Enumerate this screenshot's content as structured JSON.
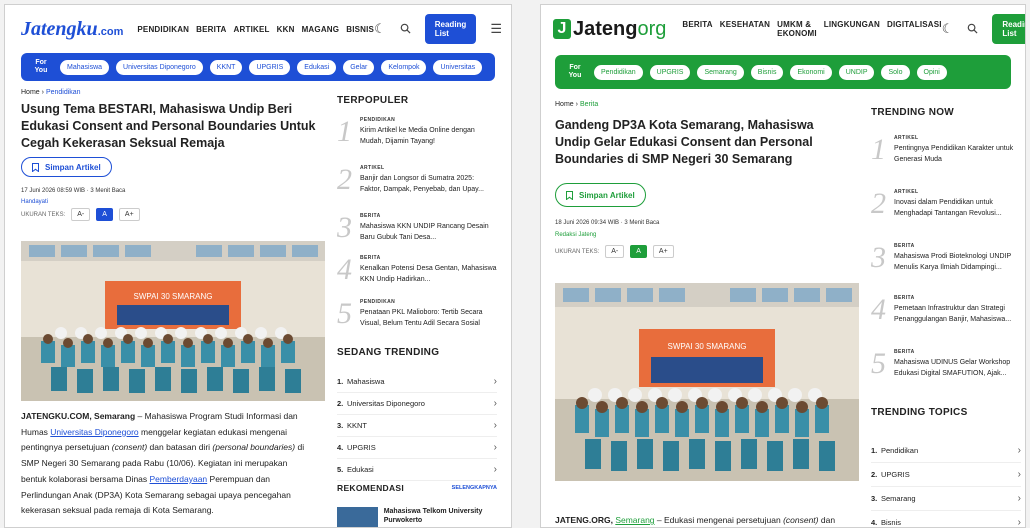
{
  "left": {
    "logo_main": "Jatengku",
    "logo_domain": ".com",
    "nav": [
      "PENDIDIKAN",
      "BERITA",
      "ARTIKEL",
      "KKN",
      "MAGANG",
      "BISNIS"
    ],
    "reading_list": "Reading List",
    "for_you": "For You",
    "tags": [
      "Mahasiswa",
      "Universitas Diponegoro",
      "KKNT",
      "UPGRIS",
      "Edukasi",
      "Gelar",
      "Kelompok",
      "Universitas"
    ],
    "crumb_home": "Home",
    "crumb_sep": "›",
    "crumb_cat": "Pendidikan",
    "title": "Usung Tema BESTARI, Mahasiswa Undip Beri Edukasi Consent and Personal Boundaries Untuk Cegah Kekerasan Seksual Remaja",
    "save": "Simpan Artikel",
    "meta": "17 Juni 2026 08:59 WIB · 3 Menit Baca",
    "author": "Handayati",
    "fontsize_label": "UKURAN TEKS:",
    "font_buttons": [
      "A-",
      "A",
      "A+"
    ],
    "body_1_brand": "JATENGKU.COM, Semarang",
    "body_1a": " – Mahasiswa Program Studi Informasi dan Humas ",
    "body_1_link": "Universitas Diponegoro",
    "body_1b": " menggelar kegiatan edukasi mengenai pentingnya persetujuan ",
    "body_1_i1": "(consent)",
    "body_1c": " dan batasan diri ",
    "body_1_i2": "(personal boundaries)",
    "body_1d": " di SMP Negeri 30 Semarang pada Rabu (10/06). Kegiatan ini merupakan bentuk kolaborasi bersama Dinas ",
    "body_1_link2": "Pemberdayaan",
    "body_1e": " Perempuan dan Perlindungan Anak (DP3A) Kota Semarang sebagai upaya pencegahan kekerasan seksual pada remaja di Kota Semarang.",
    "populer_heading": "TERPOPULER",
    "populer": [
      {
        "num": "1",
        "cat": "PENDIDIKAN",
        "title": "Kirim Artikel ke Media Online dengan Mudah, Dijamin Tayang!"
      },
      {
        "num": "2",
        "cat": "ARTIKEL",
        "title": "Banjir dan Longsor di Sumatra 2025: Faktor, Dampak, Penyebab, dan Upay..."
      },
      {
        "num": "3",
        "cat": "BERITA",
        "title": "Mahasiswa KKN UNDIP Rancang Desain Baru Gubuk Tani Desa..."
      },
      {
        "num": "4",
        "cat": "BERITA",
        "title": "Kenalkan Potensi Desa Gentan, Mahasiswa KKN Undip Hadirkan..."
      },
      {
        "num": "5",
        "cat": "PENDIDIKAN",
        "title": "Penataan PKL Malioboro: Tertib Secara Visual, Belum Tentu Adil Secara Sosial"
      }
    ],
    "trending_heading": "SEDANG TRENDING",
    "trending": [
      {
        "num": "1.",
        "label": "Mahasiswa"
      },
      {
        "num": "2.",
        "label": "Universitas Diponegoro"
      },
      {
        "num": "3.",
        "label": "KKNT"
      },
      {
        "num": "4.",
        "label": "UPGRIS"
      },
      {
        "num": "5.",
        "label": "Edukasi"
      }
    ],
    "rekom_heading": "REKOMENDASI",
    "rekom_more": "SELENGKAPNYA",
    "rekom_title": "Mahasiswa Telkom University Purwokerto",
    "photo_banner": "SWPAI 30 SMARANG"
  },
  "right": {
    "logo_main": "Jateng",
    "logo_domain": "org",
    "logo_box": "J",
    "nav": [
      "BERITA",
      "KESEHATAN",
      "UMKM & EKONOMI",
      "LINGKUNGAN",
      "DIGITALISASI"
    ],
    "reading_list": "Reading List",
    "for_you": "For You",
    "tags": [
      "Pendidikan",
      "UPGRIS",
      "Semarang",
      "Bisnis",
      "Ekonomi",
      "UNDIP",
      "Solo",
      "Opini"
    ],
    "crumb_home": "Home",
    "crumb_sep": "›",
    "crumb_cat": "Berita",
    "title": "Gandeng DP3A Kota Semarang, Mahasiswa Undip Gelar Edukasi Consent dan Personal Boundaries di SMP Negeri 30 Semarang",
    "save": "Simpan Artikel",
    "meta": "18 Juni 2026 09:34 WIB · 3 Menit Baca",
    "author": "Redaksi Jateng",
    "fontsize_label": "UKURAN TEKS:",
    "font_buttons": [
      "A-",
      "A",
      "A+"
    ],
    "body_brand": "JATENG.ORG,",
    "body_link": "Semarang",
    "body_text": " – Edukasi mengenai persetujuan ",
    "body_italic": "(consent)",
    "body_tail": " dan",
    "trending_now_heading": "TRENDING NOW",
    "trending_now": [
      {
        "num": "1",
        "cat": "ARTIKEL",
        "title": "Pentingnya Pendidikan Karakter untuk Generasi Muda"
      },
      {
        "num": "2",
        "cat": "ARTIKEL",
        "title": "Inovasi dalam Pendidikan untuk Menghadapi Tantangan Revolusi..."
      },
      {
        "num": "3",
        "cat": "BERITA",
        "title": "Mahasiswa Prodi Bioteknologi UNDIP Menulis Karya Ilmiah Didampingi..."
      },
      {
        "num": "4",
        "cat": "BERITA",
        "title": "Pemetaan Infrastruktur dan Strategi Penanggulangan Banjir, Mahasiswa..."
      },
      {
        "num": "5",
        "cat": "BERITA",
        "title": "Mahasiswa UDINUS Gelar Workshop Edukasi Digital SMAFUTION, Ajak..."
      }
    ],
    "topics_heading": "TRENDING TOPICS",
    "topics": [
      {
        "num": "1.",
        "label": "Pendidikan"
      },
      {
        "num": "2.",
        "label": "UPGRIS"
      },
      {
        "num": "3.",
        "label": "Semarang"
      },
      {
        "num": "4.",
        "label": "Bisnis"
      }
    ],
    "photo_banner": "SWPAI 30 SMARANG"
  },
  "icons": {
    "moon": "moon-icon",
    "search": "search-icon",
    "menu": "menu-icon",
    "bookmark": "bookmark-icon",
    "chevron": "chevron-right-icon"
  },
  "colors": {
    "jatengku_blue": "#1e4fd6",
    "jateng_green": "#1e9e3a"
  }
}
